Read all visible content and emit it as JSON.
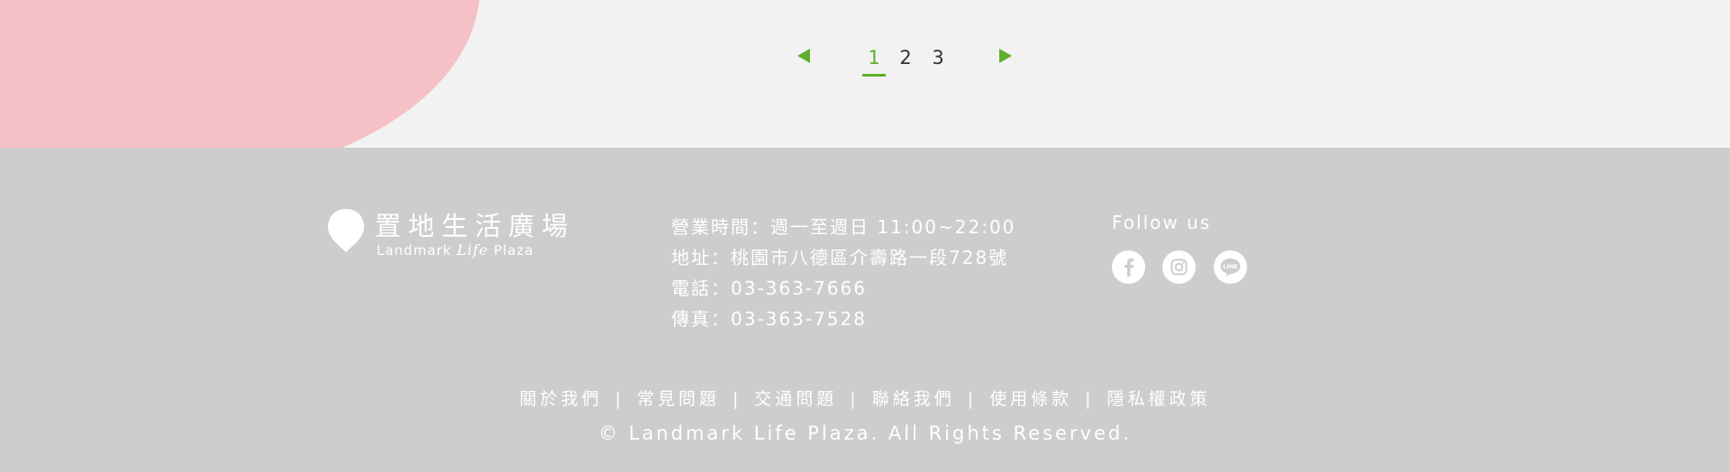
{
  "pagination": {
    "pages": [
      "1",
      "2",
      "3"
    ],
    "current_page": "1",
    "prev_icon": "triangle-left-icon",
    "next_icon": "triangle-right-icon",
    "accent_color": "#5fae2e"
  },
  "decor": {
    "pink_color": "#f5c1c6"
  },
  "footer": {
    "background": "#cdcdcd",
    "logo": {
      "name_zh": "置地生活廣場",
      "name_en_pre": "Landmark",
      "name_en_script": "Life",
      "name_en_post": "Plaza"
    },
    "info": {
      "hours": "營業時間：週一至週日 11:00~22:00",
      "address": "地址：桃園市八德區介壽路一段728號",
      "phone": "電話：03-363-7666",
      "fax": "傳真：03-363-7528"
    },
    "follow_label": "Follow us",
    "social": [
      {
        "icon": "facebook-icon",
        "label": "f"
      },
      {
        "icon": "instagram-icon",
        "label": ""
      },
      {
        "icon": "line-icon",
        "label": "LINE"
      }
    ],
    "links": [
      "關於我們",
      "常見問題",
      "交通問題",
      "聯絡我們",
      "使用條款",
      "隱私權政策"
    ],
    "link_separator": "|",
    "copyright": "© Landmark Life Plaza. All Rights Reserved."
  }
}
